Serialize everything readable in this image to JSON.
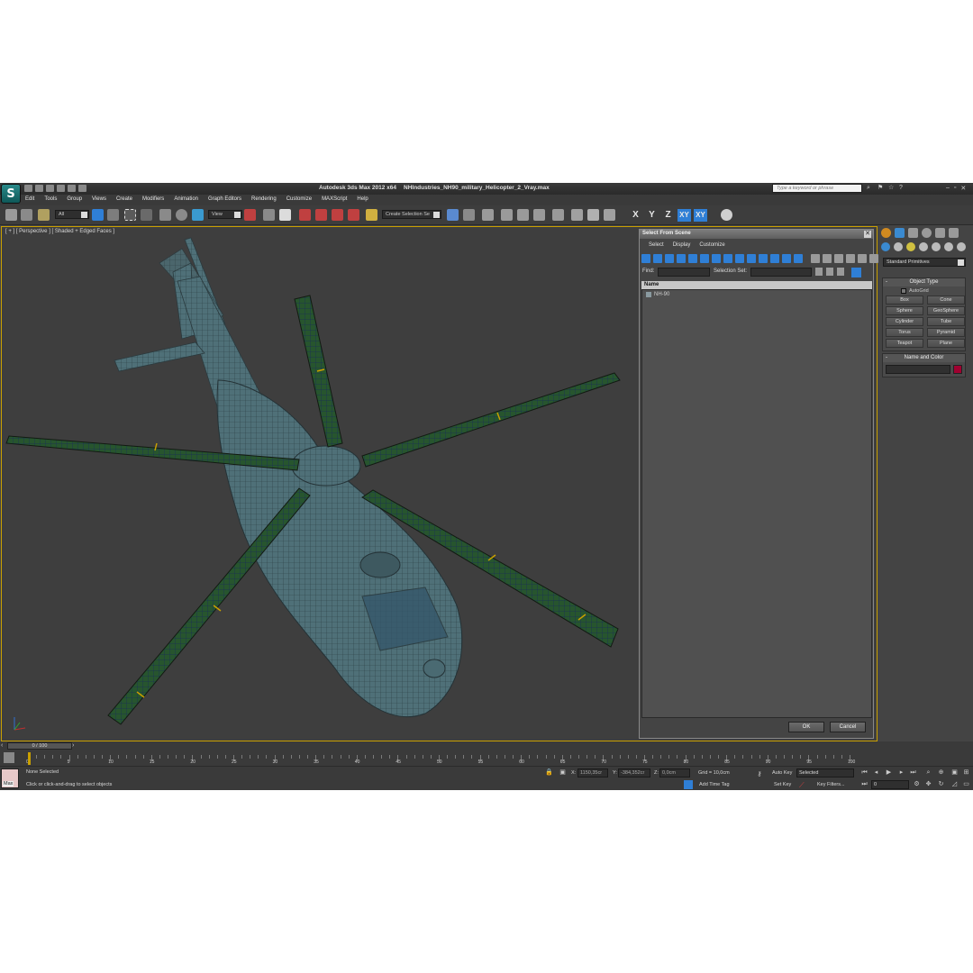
{
  "app": {
    "title": "Autodesk 3ds Max  2012 x64",
    "document": "NHIndustries_NH90_military_Helicopter_2_Vray.max",
    "search_placeholder": "Type a keyword or phrase",
    "logo_glyph": "S"
  },
  "menu": [
    "Edit",
    "Tools",
    "Group",
    "Views",
    "Create",
    "Modifiers",
    "Animation",
    "Graph Editors",
    "Rendering",
    "Customize",
    "MAXScript",
    "Help"
  ],
  "toolbar": {
    "filter_value": "All",
    "refcoord_value": "View",
    "selection_set_placeholder": "Create Selection Se",
    "axes": [
      "X",
      "Y",
      "Z",
      "XY",
      "XY"
    ]
  },
  "viewport": {
    "label": "[ + ] [ Perspective ] [ Shaded + Edged Faces ]",
    "wire_color": "#3b6a74",
    "blade_color": "#22502e"
  },
  "dialog": {
    "title": "Select From Scene",
    "menu": [
      "Select",
      "Display",
      "Customize"
    ],
    "find_label": "Find:",
    "selection_set_label": "Selection Set:",
    "column_header": "Name",
    "items": [
      "NH-90"
    ],
    "ok_label": "OK",
    "cancel_label": "Cancel"
  },
  "command_panel": {
    "category": "Standard Primitives",
    "object_type_title": "Object Type",
    "autogrid_label": "AutoGrid",
    "primitives": [
      "Box",
      "Cone",
      "Sphere",
      "GeoSphere",
      "Cylinder",
      "Tube",
      "Torus",
      "Pyramid",
      "Teapot",
      "Plane"
    ],
    "name_color_title": "Name and Color",
    "object_color": "#a00030"
  },
  "timeline": {
    "frame_display": "0 / 100",
    "ticks": [
      "0",
      "5",
      "10",
      "15",
      "20",
      "25",
      "30",
      "35",
      "40",
      "45",
      "50",
      "55",
      "60",
      "65",
      "70",
      "75",
      "80",
      "85",
      "90",
      "95",
      "100"
    ]
  },
  "status": {
    "maxscript_label": "Max",
    "selection_status": "None Selected",
    "prompt": "Click or click-and-drag to select objects",
    "x_label": "X:",
    "x_value": "1150,35cr",
    "y_label": "Y:",
    "y_value": "-384,352cr",
    "z_label": "Z:",
    "z_value": "0,0cm",
    "grid": "Grid = 10,0cm",
    "add_time_tag": "Add Time Tag",
    "auto_key": "Auto Key",
    "set_key": "Set Key",
    "key_mode_value": "Selected",
    "key_filters": "Key Filters...",
    "current_frame": "0"
  }
}
